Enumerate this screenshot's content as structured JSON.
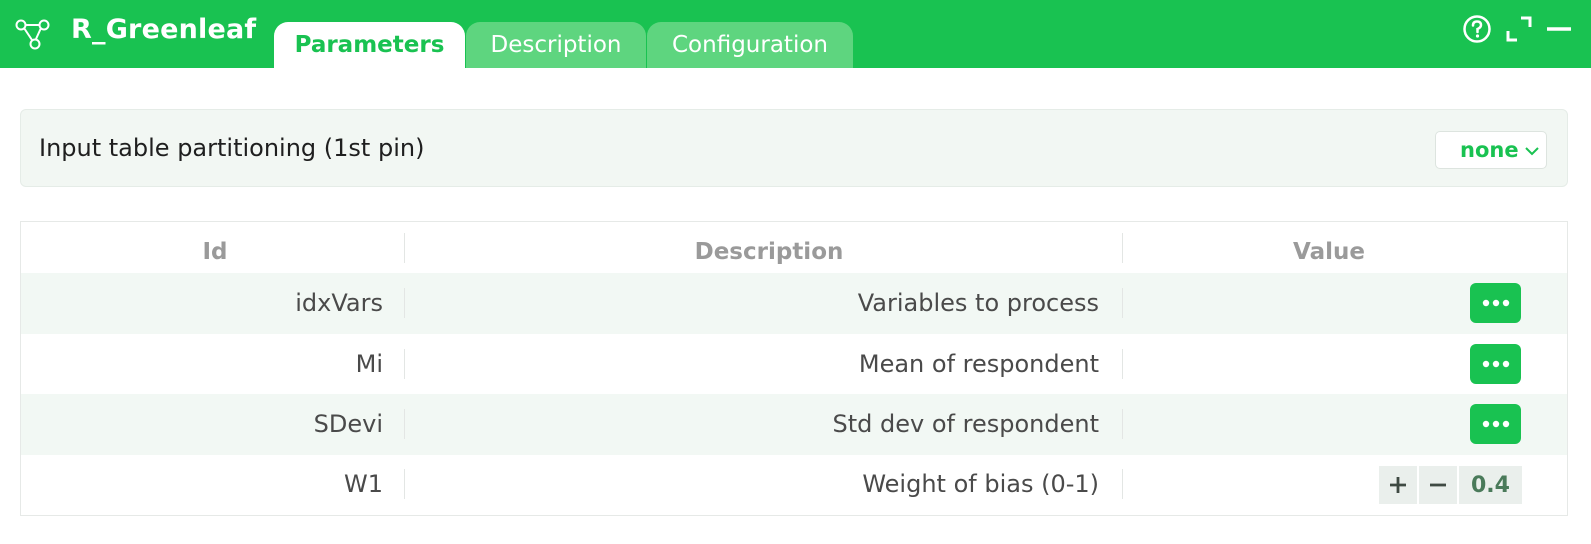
{
  "app": {
    "title": "R_Greenleaf",
    "icon": "node-tree-icon"
  },
  "tabs": [
    {
      "label": "Parameters",
      "active": true
    },
    {
      "label": "Description",
      "active": false
    },
    {
      "label": "Configuration",
      "active": false
    }
  ],
  "window_controls": [
    "help-icon",
    "expand-icon",
    "minimize-icon"
  ],
  "partitioning": {
    "label": "Input table partitioning (1st pin)",
    "selected": "none"
  },
  "table": {
    "headers": {
      "id": "Id",
      "description": "Description",
      "value": "Value"
    },
    "rows": [
      {
        "id": "idxVars",
        "description": "Variables to process",
        "value_type": "more"
      },
      {
        "id": "Mi",
        "description": "Mean of respondent",
        "value_type": "more"
      },
      {
        "id": "SDevi",
        "description": "Std dev of respondent",
        "value_type": "more"
      },
      {
        "id": "W1",
        "description": "Weight of bias (0-1)",
        "value_type": "stepper",
        "value": "0.4"
      }
    ]
  },
  "colors": {
    "brand_green": "#19c251",
    "inactive_tab": "#5ed57f",
    "row_alt": "#f2f8f4"
  }
}
